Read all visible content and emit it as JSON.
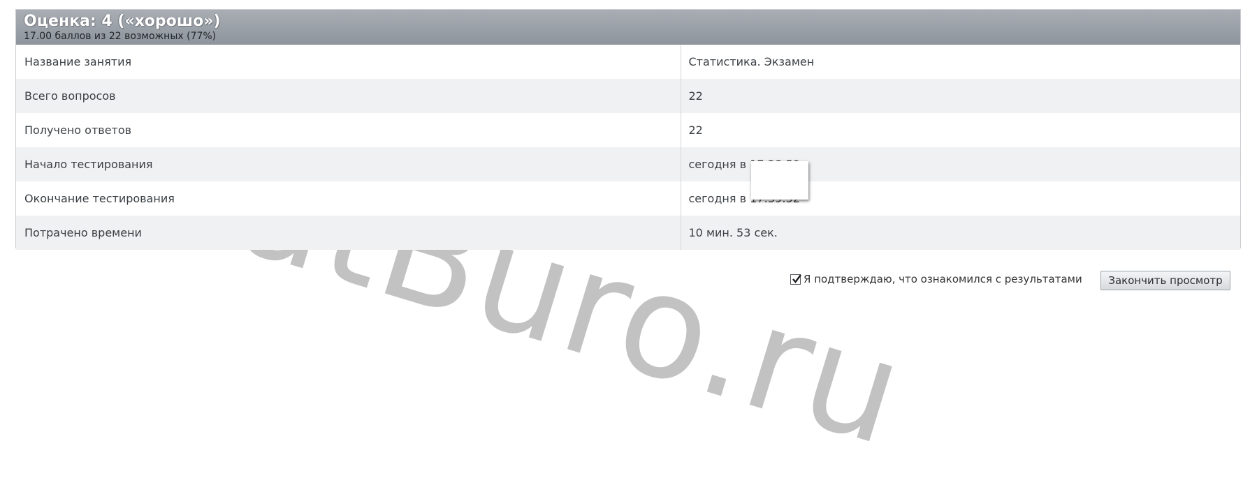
{
  "header": {
    "grade": "Оценка: 4 («хорошо»)",
    "score_summary": "17.00 баллов из 22 возможных (77%)"
  },
  "rows": [
    {
      "label": "Название занятия",
      "value": "Статистика. Экзамен"
    },
    {
      "label": "Всего вопросов",
      "value": "22"
    },
    {
      "label": "Получено ответов",
      "value": "22"
    },
    {
      "label": "Начало тестирования",
      "value": "сегодня в 17:28:59"
    },
    {
      "label": "Окончание тестирования",
      "value": "сегодня в 17:39:52"
    },
    {
      "label": "Потрачено времени",
      "value": "10 мин. 53 сек."
    }
  ],
  "confirm": {
    "checked": true,
    "label": "Я подтверждаю, что ознакомился с результатами"
  },
  "finish_button": "Закончить просмотр",
  "watermark": "MatBuro.ru",
  "colors": {
    "header_bg": "#9aa0a7",
    "row_alt_bg": "#f0f1f2"
  }
}
